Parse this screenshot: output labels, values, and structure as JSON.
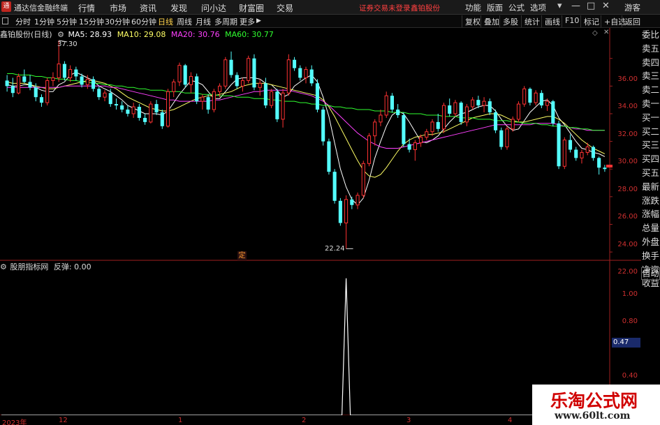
{
  "menubar": {
    "app_title": "通达信金融终端",
    "logo_glyph": "通",
    "menus": [
      "行情",
      "市场",
      "资讯",
      "发现",
      "问小达",
      "财富圈",
      "交易"
    ],
    "notice": "证券交易未登录",
    "notice_stock": "鑫铂股份",
    "right_menus": [
      "功能",
      "版面",
      "公式",
      "选项"
    ],
    "user": "游客",
    "window_controls": [
      "▾",
      "—",
      "□",
      "✕"
    ]
  },
  "toolbar": {
    "periods": [
      "分时",
      "1分钟",
      "5分钟",
      "15分钟",
      "30分钟",
      "60分钟",
      "日线",
      "周线",
      "月线",
      "多周期",
      "更多"
    ],
    "active_period": "日线",
    "right_buttons": [
      "复权",
      "叠加",
      "多股",
      "统计",
      "画线",
      "F10",
      "标记",
      "+自选",
      "返回"
    ]
  },
  "legend_main": {
    "stock": "鑫铂股份(日线)",
    "ma5_label": "MA5: 28.93",
    "ma10_label": "MA10: 29.08",
    "ma20_label": "MA20: 30.76",
    "ma60_label": "MA60: 30.77",
    "colors": {
      "ma5": "#ffffff",
      "ma10": "#ffff66",
      "ma20": "#ff40ff",
      "ma60": "#30ff30"
    }
  },
  "legend_indicator": {
    "name": "股朋指标网",
    "value_label": "反弹: 0.00"
  },
  "price_axis": [
    "36.00",
    "34.00",
    "32.00",
    "30.00",
    "28.00",
    "26.00",
    "24.00",
    "22.00"
  ],
  "indicator_axis": [
    "1.00",
    "0.80",
    "0.40"
  ],
  "indicator_current": "0.47",
  "annotations": {
    "high": "37.30",
    "low": "22.24",
    "marker": "定"
  },
  "date_axis": [
    "2023年",
    "12",
    "1",
    "2",
    "3",
    "4"
  ],
  "side_panel": [
    "委比",
    "卖五",
    "卖四",
    "卖三",
    "卖二",
    "卖一",
    "买一",
    "买二",
    "买三",
    "买四",
    "买五",
    "最新",
    "涨跌",
    "涨幅",
    "总量",
    "外盘",
    "换手",
    "净资",
    "收益"
  ],
  "side_auto": "自动",
  "watermark": {
    "title": "乐淘公式网",
    "url": "www.60lt.com"
  },
  "colors": {
    "up": "#ff3232",
    "down": "#54ffff",
    "axis": "#d03030",
    "accent": "#ffd24c"
  },
  "chart_data": {
    "type": "candlestick",
    "title": "鑫铂股份(日线)",
    "period": "daily",
    "ylim": [
      21.5,
      37.5
    ],
    "ohlc": [
      [
        34.4,
        34.8,
        33.6,
        34.0
      ],
      [
        34.0,
        34.6,
        33.2,
        33.5
      ],
      [
        33.5,
        34.9,
        33.4,
        34.7
      ],
      [
        34.7,
        35.2,
        34.2,
        34.3
      ],
      [
        34.3,
        34.8,
        33.7,
        33.9
      ],
      [
        33.9,
        34.2,
        32.9,
        33.2
      ],
      [
        33.2,
        33.4,
        32.5,
        32.8
      ],
      [
        32.8,
        34.6,
        32.6,
        34.4
      ],
      [
        34.4,
        35.0,
        34.0,
        34.6
      ],
      [
        34.6,
        37.3,
        34.3,
        35.6
      ],
      [
        35.6,
        35.8,
        34.4,
        34.6
      ],
      [
        34.6,
        35.5,
        34.3,
        35.2
      ],
      [
        35.2,
        35.4,
        34.4,
        34.7
      ],
      [
        34.7,
        34.9,
        33.9,
        34.1
      ],
      [
        34.1,
        34.8,
        33.8,
        34.5
      ],
      [
        34.5,
        34.7,
        33.6,
        33.8
      ],
      [
        33.8,
        34.0,
        33.0,
        33.2
      ],
      [
        33.2,
        33.7,
        32.9,
        33.5
      ],
      [
        33.5,
        33.8,
        32.5,
        32.7
      ],
      [
        32.7,
        33.1,
        32.3,
        32.6
      ],
      [
        32.6,
        32.9,
        32.1,
        32.3
      ],
      [
        32.3,
        32.6,
        31.8,
        32.0
      ],
      [
        32.0,
        32.8,
        31.7,
        32.5
      ],
      [
        32.5,
        32.7,
        31.5,
        31.7
      ],
      [
        31.7,
        32.0,
        31.2,
        31.4
      ],
      [
        31.4,
        32.9,
        31.3,
        32.7
      ],
      [
        32.7,
        33.0,
        31.9,
        32.1
      ],
      [
        32.1,
        32.3,
        30.9,
        31.1
      ],
      [
        31.1,
        33.8,
        31.0,
        33.6
      ],
      [
        33.6,
        34.5,
        33.2,
        34.3
      ],
      [
        34.3,
        35.7,
        34.0,
        35.5
      ],
      [
        35.5,
        35.6,
        33.9,
        34.1
      ],
      [
        34.1,
        35.0,
        33.5,
        34.7
      ],
      [
        34.7,
        34.9,
        32.7,
        32.9
      ],
      [
        32.9,
        33.4,
        32.3,
        33.2
      ],
      [
        33.2,
        33.4,
        32.0,
        32.3
      ],
      [
        32.3,
        33.8,
        32.1,
        33.6
      ],
      [
        33.6,
        34.2,
        33.2,
        34.0
      ],
      [
        34.0,
        36.1,
        33.8,
        35.9
      ],
      [
        35.9,
        36.5,
        34.6,
        34.8
      ],
      [
        34.8,
        35.0,
        33.8,
        34.0
      ],
      [
        34.0,
        34.6,
        33.6,
        34.4
      ],
      [
        34.4,
        36.2,
        34.2,
        36.0
      ],
      [
        36.0,
        36.3,
        33.7,
        33.9
      ],
      [
        33.9,
        34.5,
        33.3,
        34.2
      ],
      [
        34.2,
        34.6,
        32.4,
        32.6
      ],
      [
        32.6,
        33.8,
        32.4,
        33.6
      ],
      [
        33.6,
        33.8,
        31.4,
        31.6
      ],
      [
        31.6,
        33.8,
        31.0,
        33.5
      ],
      [
        33.5,
        36.3,
        33.3,
        35.9
      ],
      [
        35.9,
        36.1,
        35.1,
        35.3
      ],
      [
        35.3,
        35.5,
        34.4,
        34.6
      ],
      [
        34.6,
        35.4,
        34.2,
        35.2
      ],
      [
        35.2,
        35.5,
        34.0,
        34.2
      ],
      [
        34.2,
        34.5,
        32.1,
        32.3
      ],
      [
        32.3,
        32.5,
        29.7,
        30.0
      ],
      [
        30.0,
        30.2,
        27.6,
        27.8
      ],
      [
        27.8,
        28.0,
        25.5,
        25.7
      ],
      [
        25.7,
        25.9,
        23.9,
        24.1
      ],
      [
        24.1,
        26.1,
        22.24,
        25.8
      ],
      [
        25.8,
        26.0,
        25.1,
        25.4
      ],
      [
        25.4,
        26.3,
        25.1,
        26.1
      ],
      [
        26.1,
        28.6,
        25.9,
        28.4
      ],
      [
        28.4,
        30.6,
        28.2,
        30.4
      ],
      [
        30.4,
        31.6,
        29.7,
        31.4
      ],
      [
        31.4,
        32.3,
        31.1,
        31.9
      ],
      [
        31.9,
        33.6,
        31.7,
        33.3
      ],
      [
        33.3,
        33.5,
        32.1,
        32.3
      ],
      [
        32.3,
        32.7,
        31.7,
        31.9
      ],
      [
        31.9,
        32.1,
        29.6,
        29.8
      ],
      [
        29.8,
        30.2,
        29.2,
        29.4
      ],
      [
        29.4,
        30.1,
        28.6,
        29.9
      ],
      [
        29.9,
        30.5,
        29.6,
        30.3
      ],
      [
        30.3,
        30.9,
        30.1,
        30.7
      ],
      [
        30.7,
        31.6,
        30.4,
        31.4
      ],
      [
        31.4,
        32.0,
        30.7,
        30.9
      ],
      [
        30.9,
        32.8,
        30.6,
        32.6
      ],
      [
        32.6,
        33.1,
        31.8,
        32.0
      ],
      [
        32.0,
        33.0,
        31.8,
        32.8
      ],
      [
        32.8,
        32.9,
        31.2,
        31.4
      ],
      [
        31.4,
        32.7,
        31.1,
        32.5
      ],
      [
        32.5,
        33.2,
        32.3,
        33.0
      ],
      [
        33.0,
        33.3,
        32.4,
        32.6
      ],
      [
        32.6,
        33.2,
        32.1,
        32.9
      ],
      [
        32.9,
        33.1,
        31.9,
        32.1
      ],
      [
        32.1,
        32.3,
        30.6,
        30.8
      ],
      [
        30.8,
        31.0,
        29.4,
        29.6
      ],
      [
        29.6,
        31.1,
        29.4,
        30.9
      ],
      [
        30.9,
        31.8,
        30.7,
        31.6
      ],
      [
        31.6,
        32.9,
        31.4,
        32.7
      ],
      [
        32.7,
        34.0,
        32.5,
        33.8
      ],
      [
        33.8,
        33.9,
        32.6,
        32.8
      ],
      [
        32.8,
        33.7,
        32.6,
        33.5
      ],
      [
        33.5,
        33.7,
        32.4,
        32.6
      ],
      [
        32.6,
        33.1,
        32.2,
        32.9
      ],
      [
        32.9,
        33.0,
        31.1,
        31.3
      ],
      [
        31.3,
        31.5,
        28.0,
        28.2
      ],
      [
        28.2,
        30.3,
        28.0,
        30.1
      ],
      [
        30.1,
        30.5,
        29.2,
        29.4
      ],
      [
        29.4,
        29.6,
        28.6,
        28.8
      ],
      [
        28.8,
        29.4,
        28.4,
        29.2
      ],
      [
        29.2,
        29.9,
        29.0,
        29.6
      ],
      [
        29.6,
        29.7,
        28.6,
        28.8
      ],
      [
        28.8,
        28.9,
        27.6,
        28.1
      ],
      [
        28.1,
        28.3,
        27.8,
        28.0
      ]
    ],
    "ma": {
      "MA5": [
        34.1,
        34.0,
        34.0,
        34.1,
        34.1,
        33.9,
        33.7,
        33.6,
        33.6,
        34.1,
        34.3,
        34.8,
        35.0,
        34.8,
        34.6,
        34.4,
        34.0,
        33.8,
        33.6,
        33.3,
        33.0,
        32.6,
        32.4,
        32.2,
        32.0,
        32.0,
        32.0,
        31.9,
        32.2,
        32.8,
        33.4,
        33.9,
        34.4,
        34.3,
        34.1,
        33.6,
        33.1,
        33.1,
        33.6,
        34.1,
        34.5,
        34.6,
        34.6,
        34.6,
        34.5,
        34.2,
        34.1,
        33.7,
        33.2,
        33.4,
        34.0,
        34.3,
        34.6,
        34.8,
        34.3,
        33.2,
        31.8,
        29.9,
        28.0,
        26.7,
        25.8,
        25.4,
        25.9,
        27.2,
        28.8,
        30.0,
        31.1,
        31.9,
        32.2,
        32.0,
        31.4,
        30.7,
        30.0,
        29.9,
        30.1,
        30.4,
        30.9,
        31.4,
        31.8,
        32.0,
        32.1,
        32.3,
        32.5,
        32.6,
        32.6,
        32.2,
        31.6,
        31.1,
        30.8,
        30.9,
        31.5,
        32.1,
        32.5,
        32.9,
        33.0,
        32.6,
        31.7,
        31.2,
        30.6,
        30.0,
        29.5,
        29.4,
        29.2,
        29.1,
        28.9
      ],
      "MA10": [
        34.3,
        34.2,
        34.2,
        34.2,
        34.1,
        34.0,
        33.9,
        33.8,
        33.8,
        33.9,
        34.0,
        34.1,
        34.2,
        34.3,
        34.4,
        34.4,
        34.3,
        34.2,
        34.0,
        33.8,
        33.5,
        33.2,
        33.0,
        32.8,
        32.6,
        32.4,
        32.3,
        32.2,
        32.2,
        32.3,
        32.5,
        32.7,
        32.9,
        33.1,
        33.2,
        33.3,
        33.3,
        33.4,
        33.5,
        33.6,
        33.8,
        34.0,
        34.1,
        34.2,
        34.2,
        34.2,
        34.1,
        34.0,
        33.9,
        33.8,
        33.7,
        33.6,
        33.5,
        33.4,
        33.3,
        33.0,
        32.5,
        31.8,
        31.0,
        30.2,
        29.4,
        28.6,
        27.9,
        27.5,
        27.4,
        27.6,
        28.1,
        28.7,
        29.3,
        29.8,
        30.1,
        30.3,
        30.4,
        30.5,
        30.5,
        30.6,
        30.7,
        30.9,
        31.1,
        31.3,
        31.5,
        31.7,
        31.8,
        31.9,
        32.0,
        32.0,
        31.9,
        31.7,
        31.5,
        31.4,
        31.4,
        31.5,
        31.6,
        31.7,
        31.8,
        31.8,
        31.6,
        31.3,
        30.9,
        30.5,
        30.1,
        29.8,
        29.5,
        29.3,
        29.1
      ],
      "MA20": [
        33.9,
        33.9,
        33.9,
        33.9,
        33.9,
        33.9,
        33.9,
        33.9,
        33.9,
        33.9,
        34.0,
        34.0,
        34.0,
        34.0,
        34.0,
        34.0,
        34.0,
        34.0,
        33.9,
        33.9,
        33.8,
        33.7,
        33.6,
        33.5,
        33.4,
        33.3,
        33.2,
        33.1,
        33.0,
        33.0,
        32.9,
        32.9,
        32.9,
        32.9,
        32.9,
        32.9,
        33.0,
        33.0,
        33.1,
        33.2,
        33.3,
        33.4,
        33.5,
        33.6,
        33.6,
        33.7,
        33.7,
        33.7,
        33.7,
        33.7,
        33.6,
        33.5,
        33.4,
        33.3,
        33.1,
        32.9,
        32.6,
        32.2,
        31.8,
        31.4,
        31.0,
        30.6,
        30.3,
        30.0,
        29.8,
        29.6,
        29.5,
        29.5,
        29.5,
        29.6,
        29.7,
        29.8,
        29.9,
        30.0,
        30.1,
        30.2,
        30.3,
        30.4,
        30.5,
        30.6,
        30.7,
        30.8,
        30.9,
        31.0,
        31.1,
        31.2,
        31.2,
        31.2,
        31.2,
        31.2,
        31.2,
        31.2,
        31.3,
        31.3,
        31.3,
        31.3,
        31.2,
        31.1,
        31.0,
        30.9,
        30.9,
        30.8,
        30.8,
        30.8,
        30.8
      ],
      "MA60": [
        34.9,
        34.9,
        34.8,
        34.8,
        34.8,
        34.7,
        34.7,
        34.6,
        34.6,
        34.5,
        34.5,
        34.4,
        34.4,
        34.3,
        34.3,
        34.2,
        34.2,
        34.1,
        34.1,
        34.0,
        34.0,
        33.9,
        33.9,
        33.8,
        33.8,
        33.7,
        33.7,
        33.7,
        33.6,
        33.6,
        33.6,
        33.5,
        33.5,
        33.5,
        33.4,
        33.4,
        33.4,
        33.3,
        33.3,
        33.3,
        33.2,
        33.2,
        33.2,
        33.1,
        33.1,
        33.1,
        33.0,
        33.0,
        32.9,
        32.9,
        32.9,
        32.8,
        32.8,
        32.7,
        32.7,
        32.6,
        32.6,
        32.5,
        32.5,
        32.4,
        32.4,
        32.3,
        32.3,
        32.3,
        32.2,
        32.2,
        32.2,
        32.1,
        32.1,
        32.1,
        32.0,
        32.0,
        32.0,
        31.9,
        31.9,
        31.9,
        31.8,
        31.8,
        31.8,
        31.7,
        31.7,
        31.7,
        31.6,
        31.6,
        31.6,
        31.5,
        31.5,
        31.5,
        31.4,
        31.4,
        31.3,
        31.3,
        31.3,
        31.2,
        31.2,
        31.1,
        31.1,
        31.1,
        31.0,
        31.0,
        30.9,
        30.9,
        30.8,
        30.8,
        30.8
      ]
    },
    "indicator": {
      "name": "反弹",
      "ylim": [
        0,
        1.05
      ],
      "spike_index": 59,
      "spike_value": 1.0,
      "current": 0.0
    },
    "xlabel": "",
    "ylabel": ""
  }
}
